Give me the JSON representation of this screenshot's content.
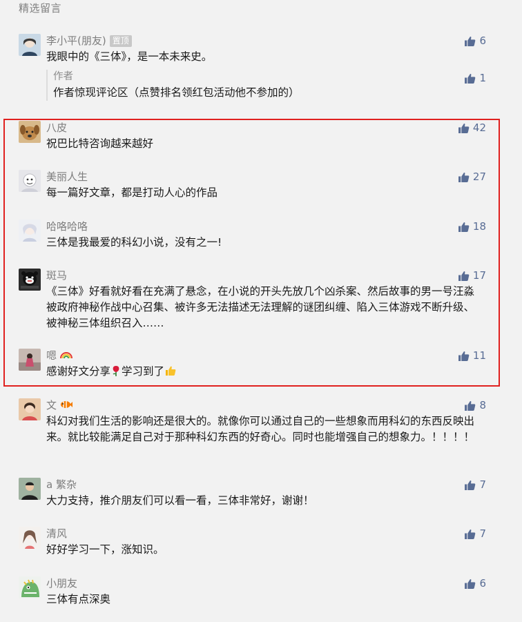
{
  "section_title": "精选留言",
  "pinned": {
    "name": "李小平(朋友)",
    "badge": "置顶",
    "text": "我眼中的《三体》，是一本未来史。",
    "likes": "6",
    "reply": {
      "author": "作者",
      "text": "作者惊现评论区（点赞排名领红包活动他不参加的）",
      "likes": "1"
    }
  },
  "comments": [
    {
      "name": "八皮",
      "text": "祝巴比特咨询越来越好",
      "likes": "42"
    },
    {
      "name": "美丽人生",
      "text": "每一篇好文章，都是打动人心的作品",
      "likes": "27"
    },
    {
      "name": "哈咯哈咯",
      "text": "三体是我最爱的科幻小说，没有之一!",
      "likes": "18"
    },
    {
      "name": "斑马",
      "text": "《三体》好看就好看在充满了悬念，在小说的开头先放几个凶杀案、然后故事的男一号汪淼被政府神秘作战中心召集、被许多无法描述无法理解的谜团纠缠、陷入三体游戏不断升级、被神秘三体组织召入……",
      "likes": "17"
    },
    {
      "name": "嗯",
      "text_a": "感谢好文分享",
      "text_b": "学习到了",
      "likes": "11"
    },
    {
      "name": "文",
      "text": "科幻对我们生活的影响还是很大的。就像你可以通过自己的一些想象而用科幻的东西反映出来。就比较能满足自己对于那种科幻东西的好奇心。同时也能增强自己的想象力。！！！！",
      "likes": "8"
    },
    {
      "name": "a 繁杂",
      "text": "大力支持，推介朋友们可以看一看，三体非常好，谢谢！",
      "likes": "7"
    },
    {
      "name": "清风",
      "text": "好好学习一下，涨知识。",
      "likes": "7"
    },
    {
      "name": "小朋友",
      "text": "三体有点深奥",
      "likes": "6"
    }
  ],
  "colors": {
    "highlight_border": "#e0201e",
    "like_color": "#586c94"
  },
  "icons": {
    "like": "thumbs-up-icon"
  }
}
